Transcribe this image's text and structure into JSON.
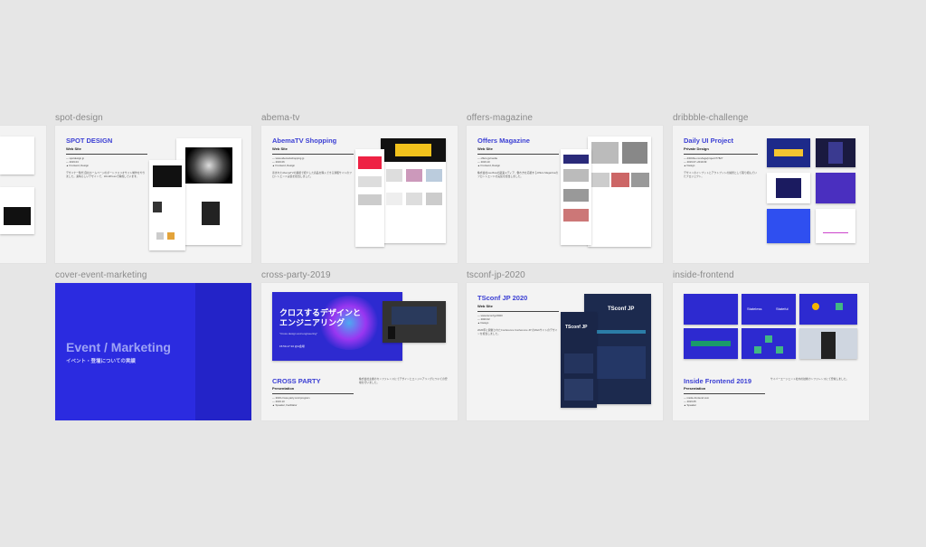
{
  "frames": [
    {
      "label": "spot-design",
      "title": "SPOT DESIGN",
      "subtitle": "Web Site",
      "meta": [
        "— spotdesign.jp",
        "— 2019.04",
        "▲ Frontend, Design"
      ],
      "description": "デザイナー時代 自社ホームページのポートフォリオサイト制作をやりました。素晴らしいデザインで、WordPressで構成しています。"
    },
    {
      "label": "abema-tv",
      "title": "AbemaTV Shopping",
      "subtitle": "Web Site",
      "meta": [
        "— www.abematvshopping.jp",
        "— 2019.06",
        "▲ Frontend, Design"
      ],
      "description": "恵まれたAbemaTVの番組で紹介した商品を購入できる通販サイトのフロントエンド実装を担当しました。"
    },
    {
      "label": "offers-magazine",
      "title": "Offers Magazine",
      "subtitle": "Web Site",
      "meta": [
        "— offers.jp/media",
        "— 2019.10",
        "▲ Frontend, Design"
      ],
      "description": "株式会社overflowの副業メディア、働き方を応援するOffers Magazineのフロントエンドの実装を担当しました。"
    },
    {
      "label": "dribbble-challenge",
      "title": "Daily UI Project",
      "subtitle": "Private Design",
      "meta": [
        "— dribbble.com/tags/project/77827",
        "— 2019.07–2019.09",
        "▲ Design"
      ],
      "description": "デザインのインプットとアウトプットの練習として取り組んでいたプロジェクト。"
    },
    {
      "label": "cover-event-marketing",
      "cover_title": "Event / Marketing",
      "cover_subtitle": "イベント・登壇についての実績"
    },
    {
      "label": "cross-party-2019",
      "title": "CROSS PARTY",
      "subtitle": "Presentation",
      "meta": [
        "— 2019.cross-party.com/program",
        "— 2019.10",
        "▲ Speaker, Facilitator"
      ],
      "description": "株式会社主催のカンファレンスにてデザインとエンジニアリングについての登壇を行いました。",
      "slide_title": "クロスするデザインと エンジニアリング",
      "slide_sub": "\"Cross design and engineering\"",
      "slide_time": "15:50-17:10 @A会場"
    },
    {
      "label": "tsconf-jp-2020",
      "title": "TSconf JP 2020",
      "subtitle": "Web Site",
      "meta": [
        "— www.tsconf.jp/2020",
        "— 2020.02",
        "▲ Design"
      ],
      "description": "2020年に開催されたConference Conference JP のWebサイトのデザインを担当しました。",
      "shot_title": "TSconf JP"
    },
    {
      "label": "inside-frontend",
      "title": "Inside Frontend 2019",
      "subtitle": "Presentation",
      "meta": [
        "— inside-frontend.com",
        "— 2019.05",
        "▲ Speaker"
      ],
      "description": "サイバーエージェント社内の技術カンファレンスにて登壇しました。",
      "slide_a": "Stateless",
      "slide_b": "Stateful"
    }
  ],
  "colors": {
    "canvas_bg": "#e6e6e6",
    "frame_bg": "#f3f3f3",
    "accent": "#3b3fd4",
    "cover_bg": "#2b2be0"
  }
}
